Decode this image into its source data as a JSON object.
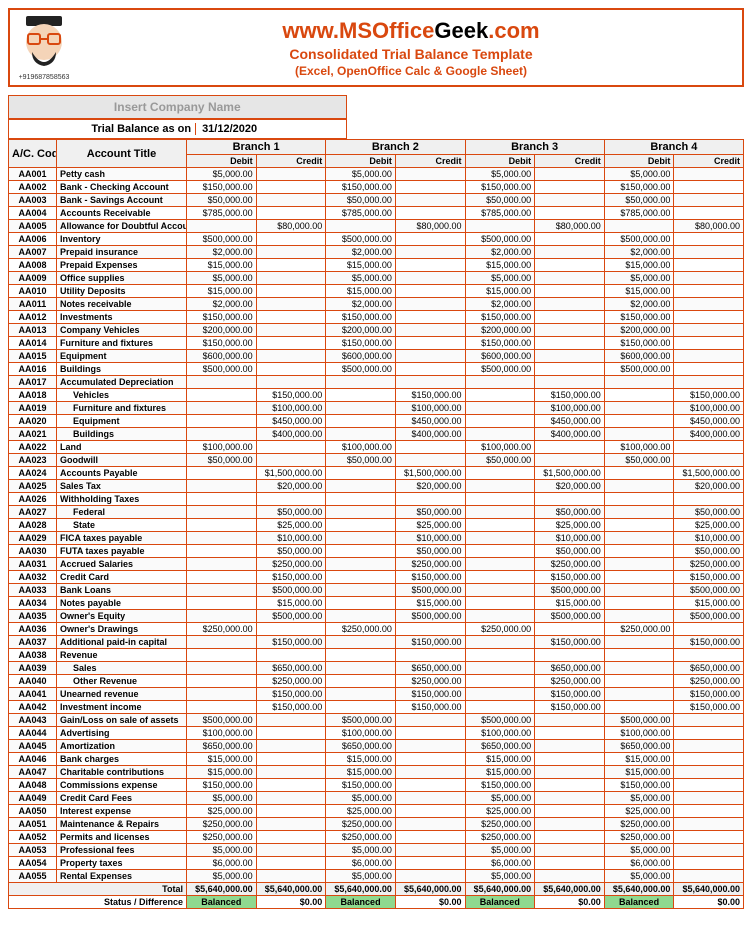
{
  "header": {
    "phone": "+919687858563",
    "url_parts": [
      "www.",
      "MSOffice",
      "Geek",
      ".com"
    ],
    "subtitle1": "Consolidated Trial Balance Template",
    "subtitle2": "(Excel, OpenOffice Calc & Google Sheet)"
  },
  "company_placeholder": "Insert Company Name",
  "date_label": "Trial Balance as on",
  "date_value": "31/12/2020",
  "branches": [
    "Branch 1",
    "Branch 2",
    "Branch 3",
    "Branch 4"
  ],
  "col_headers": {
    "code": "A/C. Code",
    "title": "Account Title",
    "debit": "Debit",
    "credit": "Credit"
  },
  "totals": {
    "label": "Total",
    "debit": "$5,640,000.00",
    "credit": "$5,640,000.00"
  },
  "status": {
    "label": "Status / Difference",
    "balanced": "Balanced",
    "diff": "$0.00"
  },
  "rows": [
    {
      "code": "AA001",
      "title": "Petty cash",
      "debit": "$5,000.00",
      "credit": ""
    },
    {
      "code": "AA002",
      "title": "Bank - Checking Account",
      "debit": "$150,000.00",
      "credit": ""
    },
    {
      "code": "AA003",
      "title": "Bank - Savings Account",
      "debit": "$50,000.00",
      "credit": ""
    },
    {
      "code": "AA004",
      "title": "Accounts Receivable",
      "debit": "$785,000.00",
      "credit": ""
    },
    {
      "code": "AA005",
      "title": "Allowance for Doubtful Accounts",
      "debit": "",
      "credit": "$80,000.00"
    },
    {
      "code": "AA006",
      "title": "Inventory",
      "debit": "$500,000.00",
      "credit": ""
    },
    {
      "code": "AA007",
      "title": "Prepaid insurance",
      "debit": "$2,000.00",
      "credit": ""
    },
    {
      "code": "AA008",
      "title": "Prepaid Expenses",
      "debit": "$15,000.00",
      "credit": ""
    },
    {
      "code": "AA009",
      "title": "Office supplies",
      "debit": "$5,000.00",
      "credit": ""
    },
    {
      "code": "AA010",
      "title": "Utility Deposits",
      "debit": "$15,000.00",
      "credit": ""
    },
    {
      "code": "AA011",
      "title": "Notes receivable",
      "debit": "$2,000.00",
      "credit": ""
    },
    {
      "code": "AA012",
      "title": "Investments",
      "debit": "$150,000.00",
      "credit": ""
    },
    {
      "code": "AA013",
      "title": "Company Vehicles",
      "debit": "$200,000.00",
      "credit": ""
    },
    {
      "code": "AA014",
      "title": "Furniture and fixtures",
      "debit": "$150,000.00",
      "credit": ""
    },
    {
      "code": "AA015",
      "title": "Equipment",
      "debit": "$600,000.00",
      "credit": ""
    },
    {
      "code": "AA016",
      "title": "Buildings",
      "debit": "$500,000.00",
      "credit": ""
    },
    {
      "code": "AA017",
      "title": "Accumulated Depreciation",
      "debit": "",
      "credit": ""
    },
    {
      "code": "AA018",
      "title": "Vehicles",
      "indent": true,
      "debit": "",
      "credit": "$150,000.00"
    },
    {
      "code": "AA019",
      "title": "Furniture and fixtures",
      "indent": true,
      "debit": "",
      "credit": "$100,000.00"
    },
    {
      "code": "AA020",
      "title": "Equipment",
      "indent": true,
      "debit": "",
      "credit": "$450,000.00"
    },
    {
      "code": "AA021",
      "title": "Buildings",
      "indent": true,
      "debit": "",
      "credit": "$400,000.00"
    },
    {
      "code": "AA022",
      "title": "Land",
      "debit": "$100,000.00",
      "credit": ""
    },
    {
      "code": "AA023",
      "title": "Goodwill",
      "debit": "$50,000.00",
      "credit": ""
    },
    {
      "code": "AA024",
      "title": "Accounts Payable",
      "debit": "",
      "credit": "$1,500,000.00"
    },
    {
      "code": "AA025",
      "title": "Sales Tax",
      "debit": "",
      "credit": "$20,000.00"
    },
    {
      "code": "AA026",
      "title": "Withholding Taxes",
      "debit": "",
      "credit": ""
    },
    {
      "code": "AA027",
      "title": "Federal",
      "indent": true,
      "debit": "",
      "credit": "$50,000.00"
    },
    {
      "code": "AA028",
      "title": "State",
      "indent": true,
      "debit": "",
      "credit": "$25,000.00"
    },
    {
      "code": "AA029",
      "title": "FICA taxes payable",
      "debit": "",
      "credit": "$10,000.00"
    },
    {
      "code": "AA030",
      "title": "FUTA taxes payable",
      "debit": "",
      "credit": "$50,000.00"
    },
    {
      "code": "AA031",
      "title": "Accrued Salaries",
      "debit": "",
      "credit": "$250,000.00"
    },
    {
      "code": "AA032",
      "title": "Credit Card",
      "debit": "",
      "credit": "$150,000.00"
    },
    {
      "code": "AA033",
      "title": "Bank Loans",
      "debit": "",
      "credit": "$500,000.00"
    },
    {
      "code": "AA034",
      "title": "Notes payable",
      "debit": "",
      "credit": "$15,000.00"
    },
    {
      "code": "AA035",
      "title": "Owner's Equity",
      "debit": "",
      "credit": "$500,000.00"
    },
    {
      "code": "AA036",
      "title": "Owner's Drawings",
      "debit": "$250,000.00",
      "credit": ""
    },
    {
      "code": "AA037",
      "title": "Additional paid-in capital",
      "debit": "",
      "credit": "$150,000.00"
    },
    {
      "code": "AA038",
      "title": "Revenue",
      "debit": "",
      "credit": ""
    },
    {
      "code": "AA039",
      "title": "Sales",
      "indent": true,
      "debit": "",
      "credit": "$650,000.00"
    },
    {
      "code": "AA040",
      "title": "Other Revenue",
      "indent": true,
      "debit": "",
      "credit": "$250,000.00"
    },
    {
      "code": "AA041",
      "title": "Unearned revenue",
      "debit": "",
      "credit": "$150,000.00"
    },
    {
      "code": "AA042",
      "title": "Investment income",
      "debit": "",
      "credit": "$150,000.00"
    },
    {
      "code": "AA043",
      "title": "Gain/Loss on sale of assets",
      "debit": "$500,000.00",
      "credit": ""
    },
    {
      "code": "AA044",
      "title": "Advertising",
      "debit": "$100,000.00",
      "credit": ""
    },
    {
      "code": "AA045",
      "title": "Amortization",
      "debit": "$650,000.00",
      "credit": ""
    },
    {
      "code": "AA046",
      "title": "Bank charges",
      "debit": "$15,000.00",
      "credit": ""
    },
    {
      "code": "AA047",
      "title": "Charitable contributions",
      "debit": "$15,000.00",
      "credit": ""
    },
    {
      "code": "AA048",
      "title": "Commissions expense",
      "debit": "$150,000.00",
      "credit": ""
    },
    {
      "code": "AA049",
      "title": "Credit Card Fees",
      "debit": "$5,000.00",
      "credit": ""
    },
    {
      "code": "AA050",
      "title": "Interest expense",
      "debit": "$25,000.00",
      "credit": ""
    },
    {
      "code": "AA051",
      "title": "Maintenance & Repairs",
      "debit": "$250,000.00",
      "credit": ""
    },
    {
      "code": "AA052",
      "title": "Permits and licenses",
      "debit": "$250,000.00",
      "credit": ""
    },
    {
      "code": "AA053",
      "title": "Professional fees",
      "debit": "$5,000.00",
      "credit": ""
    },
    {
      "code": "AA054",
      "title": "Property taxes",
      "debit": "$6,000.00",
      "credit": ""
    },
    {
      "code": "AA055",
      "title": "Rental Expenses",
      "debit": "$5,000.00",
      "credit": ""
    }
  ]
}
